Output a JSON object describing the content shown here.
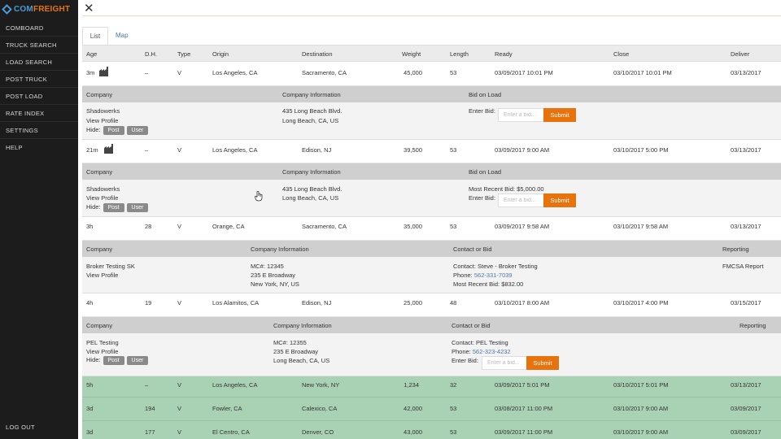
{
  "brand": {
    "part1": "COM",
    "part2": "FREIGHT"
  },
  "sidebar": {
    "items": [
      {
        "label": "COMBOARD"
      },
      {
        "label": "TRUCK SEARCH"
      },
      {
        "label": "LOAD SEARCH"
      },
      {
        "label": "POST TRUCK"
      },
      {
        "label": "POST LOAD"
      },
      {
        "label": "RATE INDEX"
      },
      {
        "label": "SETTINGS"
      },
      {
        "label": "HELP"
      }
    ],
    "logout": "LOG OUT"
  },
  "close_symbol": "✕",
  "tabs": [
    {
      "label": "List"
    },
    {
      "label": "Map"
    }
  ],
  "columns": [
    "Age",
    "D.H.",
    "Type",
    "Origin",
    "Destination",
    "Weight",
    "Length",
    "Ready",
    "Close",
    "Deliver"
  ],
  "rows": [
    {
      "age": "3m",
      "dh": "–",
      "type": "V",
      "origin": "Los Angeles, CA",
      "destination": "Sacramento, CA",
      "weight": "45,000",
      "length": "53",
      "ready": "03/09/2017 10:01 PM",
      "close": "03/10/2017 10:01 PM",
      "deliver": "03/13/2017"
    },
    {
      "age": "21m",
      "dh": "–",
      "type": "V",
      "origin": "Los Angeles, CA",
      "destination": "Edison, NJ",
      "weight": "39,500",
      "length": "53",
      "ready": "03/09/2017 9:00 AM",
      "close": "03/10/2017 5:00 PM",
      "deliver": "03/13/2017"
    },
    {
      "age": "3h",
      "dh": "28",
      "type": "V",
      "origin": "Orange, CA",
      "destination": "Sacramento, CA",
      "weight": "35,000",
      "length": "53",
      "ready": "03/09/2017 9:58 AM",
      "close": "03/10/2017 9:58 AM",
      "deliver": "03/13/2017"
    },
    {
      "age": "4h",
      "dh": "19",
      "type": "V",
      "origin": "Los Alamitos, CA",
      "destination": "Edison, NJ",
      "weight": "25,000",
      "length": "48",
      "ready": "03/10/2017 8:00 AM",
      "close": "03/10/2017 4:00 PM",
      "deliver": "03/15/2017"
    },
    {
      "age": "5h",
      "dh": "–",
      "type": "V",
      "origin": "Los Angeles, CA",
      "destination": "New York, NY",
      "weight": "1,234",
      "length": "32",
      "ready": "03/09/2017 5:01 PM",
      "close": "03/10/2017 5:01 PM",
      "deliver": "03/13/2017"
    },
    {
      "age": "3d",
      "dh": "194",
      "type": "V",
      "origin": "Fowler, CA",
      "destination": "Calexico, CA",
      "weight": "42,000",
      "length": "53",
      "ready": "03/08/2017 11:00 PM",
      "close": "03/10/2017 9:00 AM",
      "deliver": "03/09/2017"
    },
    {
      "age": "3d",
      "dh": "177",
      "type": "V",
      "origin": "El Centro, CA",
      "destination": "Denver, CO",
      "weight": "43,000",
      "length": "53",
      "ready": "03/09/2017 11:00 PM",
      "close": "03/10/2017 9:00 AM",
      "deliver": "03/09/2017"
    }
  ],
  "details": [
    {
      "headers": {
        "company": "Company",
        "info": "Company Information",
        "bid": "Bid on Load"
      },
      "company": "Shadowerks",
      "view_profile": "View Profile",
      "hide_label": "Hide:",
      "post_label": "Post",
      "user_label": "User",
      "address1": "435 Long Beach Blvd.",
      "address2": "Long Beach, CA, US",
      "enter_bid_label": "Enter Bid:",
      "bid_placeholder": "Enter a bid...",
      "submit_label": "Submit"
    },
    {
      "headers": {
        "company": "Company",
        "info": "Company Information",
        "bid": "Bid on Load"
      },
      "company": "Shadowerks",
      "view_profile": "View Profile",
      "hide_label": "Hide:",
      "post_label": "Post",
      "user_label": "User",
      "address1": "435 Long Beach Blvd.",
      "address2": "Long Beach, CA, US",
      "recent_bid": "Most Recent Bid: $5,000.00",
      "enter_bid_label": "Enter Bid:",
      "bid_placeholder": "Enter a bid...",
      "submit_label": "Submit"
    },
    {
      "headers": {
        "company": "Company",
        "info": "Company Information",
        "bid": "Contact or Bid",
        "reporting": "Reporting"
      },
      "company": "Broker Testing SK",
      "view_profile": "View Profile",
      "mc": "MC#: 12345",
      "address1": "235 E Broadway",
      "address2": "New York, NY, US",
      "contact_label": "Contact:",
      "contact": "Steve - Broker Testing",
      "phone_label": "Phone:",
      "phone": "562-331-7039",
      "recent_bid": "Most Recent Bid: $832.00",
      "report_link": "FMCSA Report"
    },
    {
      "headers": {
        "company": "Company",
        "info": "Company Information",
        "bid": "Contact or Bid",
        "reporting": "Reporting"
      },
      "company": "PEL Testing",
      "view_profile": "View Profile",
      "hide_label": "Hide:",
      "post_label": "Post",
      "user_label": "User",
      "mc": "MC#: 12355",
      "address1": "235 E Broadway",
      "address2": "Long Beach, CA, US",
      "contact_label": "Contact:",
      "contact": "PEL Testing",
      "phone_label": "Phone:",
      "phone": "562-323-4232",
      "enter_bid_label": "Enter Bid:",
      "bid_placeholder": "Enter a bid...",
      "submit_label": "Submit"
    }
  ],
  "colors": {
    "sidebar": "#1c1c1c",
    "accent_orange": "#e8730c",
    "brand_blue": "#4a9bd6",
    "highlight_row": "#a9d2b4",
    "link": "#4b79a8"
  }
}
